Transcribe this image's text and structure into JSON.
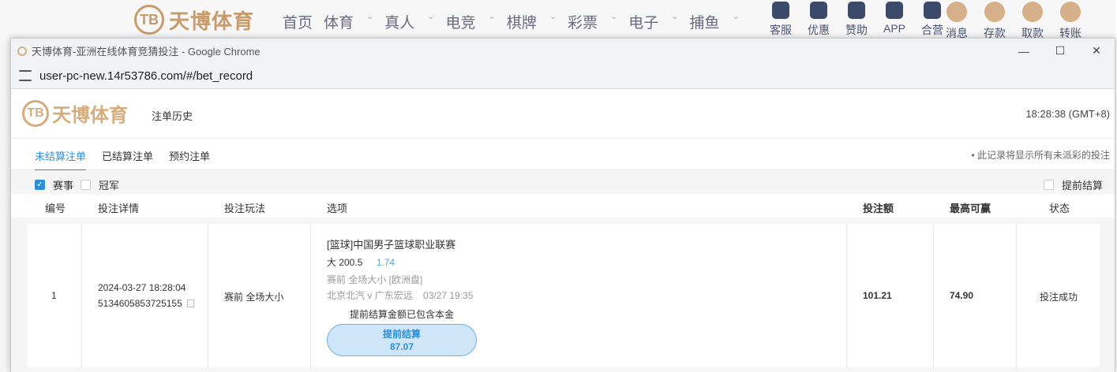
{
  "bg_site": {
    "logo_text": "天博体育",
    "logo_mark": "TB",
    "nav": [
      "首页",
      "体育",
      "真人",
      "电竞",
      "棋牌",
      "彩票",
      "电子",
      "捕鱼"
    ],
    "nav_with_caret": [
      false,
      true,
      true,
      true,
      true,
      true,
      true,
      true
    ],
    "icons": [
      {
        "label": "客服",
        "icon": "chat-icon"
      },
      {
        "label": "优惠",
        "icon": "gift-icon"
      },
      {
        "label": "赞助",
        "icon": "star-badge-icon"
      },
      {
        "label": "APP",
        "icon": "phone-icon"
      },
      {
        "label": "合营",
        "icon": "handshake-icon"
      }
    ],
    "icons2": [
      {
        "label": "消息",
        "icon": "message-icon"
      },
      {
        "label": "存款",
        "icon": "deposit-icon"
      },
      {
        "label": "取款",
        "icon": "withdraw-icon"
      },
      {
        "label": "转账",
        "icon": "transfer-icon"
      }
    ]
  },
  "window": {
    "title": "天博体育-亚洲在线体育竞猜投注 - Google Chrome",
    "url": "user-pc-new.14r53786.com/#/bet_record",
    "minimize": "—",
    "maximize": "☐",
    "close": "✕"
  },
  "app": {
    "logo_text": "天博体育",
    "logo_mark": "TB",
    "page_title": "注单历史",
    "clock": "18:28:38 (GMT+8)"
  },
  "tabs": {
    "items": [
      "未结算注单",
      "已结算注单",
      "预约注单"
    ],
    "active": 0,
    "note": "• 此记录将显示所有未派彩的投注"
  },
  "filters": {
    "event": {
      "label": "赛事",
      "checked": true
    },
    "champion": {
      "label": "冠军",
      "checked": false
    },
    "early_settle": {
      "label": "提前结算",
      "checked": false
    }
  },
  "table": {
    "headers": {
      "no": "编号",
      "detail": "投注详情",
      "play": "投注玩法",
      "option": "选项",
      "stake": "投注额",
      "max_win": "最高可赢",
      "status": "状态"
    },
    "rows": [
      {
        "no": "1",
        "time": "2024-03-27 18:28:04",
        "order_id": "5134605853725155",
        "play": "赛前 全场大小",
        "league": "[篮球]中国男子篮球职业联赛",
        "selection": "大 200.5",
        "odds": "1.74",
        "market": "赛前   全场大小   [欧洲盘]",
        "match": "北京北汽 v 广东宏远",
        "match_time": "03/27 19:35",
        "cashout_note": "提前结算金额已包含本金",
        "cashout_label": "提前结算",
        "cashout_amount": "87.07",
        "stake": "101.21",
        "max_win": "74.90",
        "status": "投注成功"
      }
    ]
  }
}
